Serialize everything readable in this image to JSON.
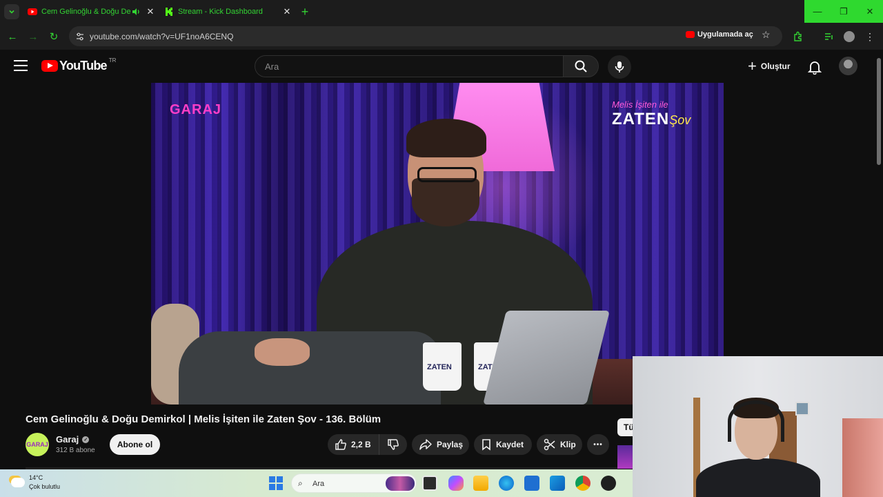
{
  "browser": {
    "tabs": [
      {
        "title": "Cem Gelinoğlu & Doğu Demirkol | Melis İşiten ile Zaten Şov",
        "active": false,
        "favicon": "youtube-icon",
        "audio": true
      },
      {
        "title": "Stream - Kick Dashboard",
        "active": true,
        "favicon": "kick-icon",
        "audio": false
      }
    ],
    "url": "youtube.com/watch?v=UF1noA6CENQ",
    "open_in_app": "Uygulamada aç",
    "accent": "#33d433"
  },
  "youtube": {
    "logo_text": "YouTube",
    "country_code": "TR",
    "search_placeholder": "Ara",
    "create_label": "Oluştur"
  },
  "video": {
    "title": "Cem Gelinoğlu & Doğu Demirkol | Melis İşiten ile Zaten Şov - 136. Bölüm",
    "overlay_left_logo": "GARAJ",
    "overlay_right_top": "Melis İşiten ile",
    "overlay_right_big": "ZATEN",
    "overlay_right_small": "Şov",
    "mug_text": "ZATEN"
  },
  "channel": {
    "name": "Garaj",
    "avatar_text": "GARAJ",
    "subscribers": "312 B abone",
    "subscribe_label": "Abone ol"
  },
  "actions": {
    "likes": "2,2 B",
    "share": "Paylaş",
    "save": "Kaydet",
    "clip": "Klip",
    "more": "•••",
    "partial_tab": "Tü"
  },
  "taskbar": {
    "temperature": "14°C",
    "weather": "Çok bulutlu",
    "search_placeholder": "Ara"
  }
}
